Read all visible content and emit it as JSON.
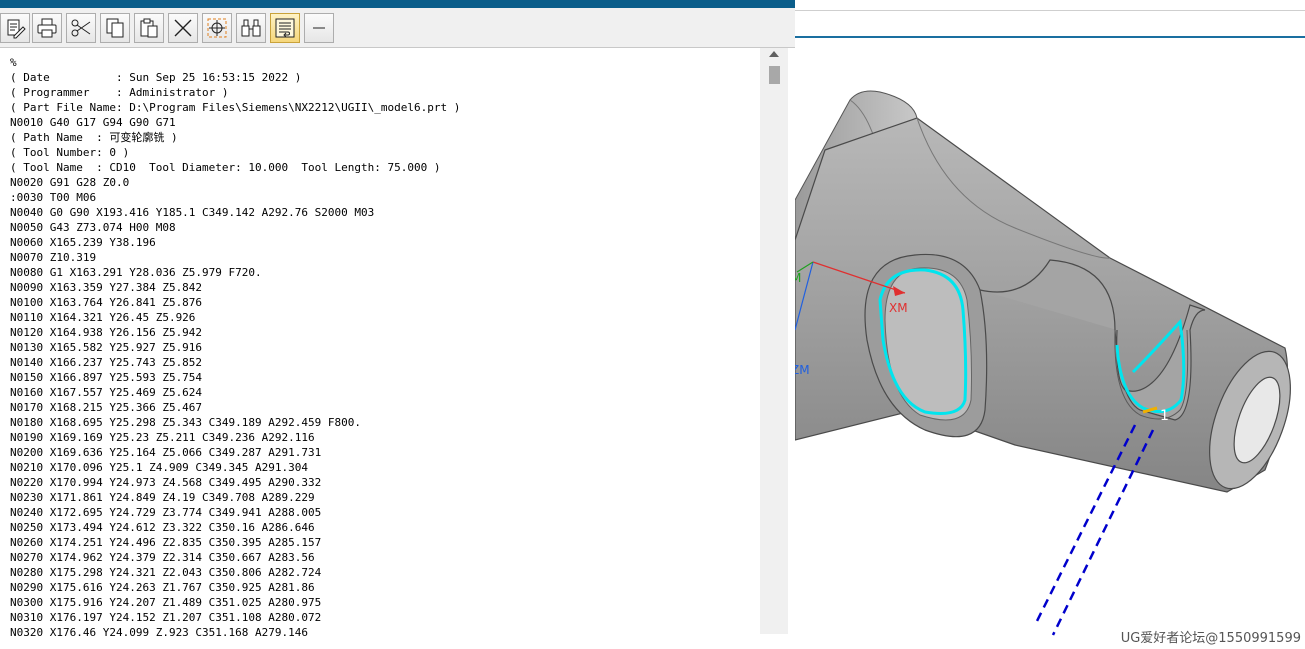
{
  "toolbar": {
    "buttons": [
      "edit",
      "print",
      "cut",
      "copy",
      "paste",
      "delete",
      "locate",
      "find",
      "wrap",
      "minimize"
    ]
  },
  "code_lines": [
    "%",
    "( Date          : Sun Sep 25 16:53:15 2022 )",
    "( Programmer    : Administrator )",
    "( Part File Name: D:\\Program Files\\Siemens\\NX2212\\UGII\\_model6.prt )",
    "N0010 G40 G17 G94 G90 G71",
    "( Path Name  : 可变轮廓铣 )",
    "( Tool Number: 0 )",
    "( Tool Name  : CD10  Tool Diameter: 10.000  Tool Length: 75.000 )",
    "N0020 G91 G28 Z0.0",
    ":0030 T00 M06",
    "N0040 G0 G90 X193.416 Y185.1 C349.142 A292.76 S2000 M03",
    "N0050 G43 Z73.074 H00 M08",
    "N0060 X165.239 Y38.196",
    "N0070 Z10.319",
    "N0080 G1 X163.291 Y28.036 Z5.979 F720.",
    "N0090 X163.359 Y27.384 Z5.842",
    "N0100 X163.764 Y26.841 Z5.876",
    "N0110 X164.321 Y26.45 Z5.926",
    "N0120 X164.938 Y26.156 Z5.942",
    "N0130 X165.582 Y25.927 Z5.916",
    "N0140 X166.237 Y25.743 Z5.852",
    "N0150 X166.897 Y25.593 Z5.754",
    "N0160 X167.557 Y25.469 Z5.624",
    "N0170 X168.215 Y25.366 Z5.467",
    "N0180 X168.695 Y25.298 Z5.343 C349.189 A292.459 F800.",
    "N0190 X169.169 Y25.23 Z5.211 C349.236 A292.116",
    "N0200 X169.636 Y25.164 Z5.066 C349.287 A291.731",
    "N0210 X170.096 Y25.1 Z4.909 C349.345 A291.304",
    "N0220 X170.994 Y24.973 Z4.568 C349.495 A290.332",
    "N0230 X171.861 Y24.849 Z4.19 C349.708 A289.229",
    "N0240 X172.695 Y24.729 Z3.774 C349.941 A288.005",
    "N0250 X173.494 Y24.612 Z3.322 C350.16 A286.646",
    "N0260 X174.251 Y24.496 Z2.835 C350.395 A285.157",
    "N0270 X174.962 Y24.379 Z2.314 C350.667 A283.56",
    "N0280 X175.298 Y24.321 Z2.043 C350.806 A282.724",
    "N0290 X175.616 Y24.263 Z1.767 C350.925 A281.86",
    "N0300 X175.916 Y24.207 Z1.489 C351.025 A280.975",
    "N0310 X176.197 Y24.152 Z1.207 C351.108 A280.072",
    "N0320 X176.46 Y24.099 Z.923 C351.168 A279.146"
  ],
  "viewport": {
    "axis_x_label": "XM",
    "axis_z_label": "ZM",
    "axis_y_label": "M",
    "path_start_label": "1"
  },
  "watermark": "UG爱好者论坛@1550991599",
  "colors": {
    "title_bar": "#0a5d8a",
    "toolpath": "#00e5ee",
    "tool_axis": "#0000cc",
    "axis_x": "#e03030",
    "axis_z": "#2060e0"
  }
}
